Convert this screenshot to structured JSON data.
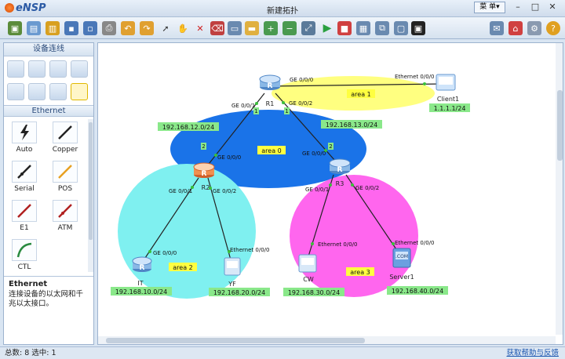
{
  "app": {
    "name": "eNSP",
    "window_title": "新建拓扑",
    "menu_label": "菜 单▾"
  },
  "left_panel": {
    "header": "设备连线",
    "ethernet_header": "Ethernet",
    "cables": [
      {
        "label": "Auto",
        "icon": "auto-lightning-icon",
        "color": "#222222"
      },
      {
        "label": "Copper",
        "icon": "copper-cable-icon",
        "color": "#222222"
      },
      {
        "label": "Serial",
        "icon": "serial-cable-icon",
        "color": "#222222"
      },
      {
        "label": "POS",
        "icon": "pos-cable-icon",
        "color": "#e8a020"
      },
      {
        "label": "E1",
        "icon": "e1-cable-icon",
        "color": "#b02020"
      },
      {
        "label": "ATM",
        "icon": "atm-cable-icon",
        "color": "#b02020"
      },
      {
        "label": "CTL",
        "icon": "ctl-cable-icon",
        "color": "#2a8a40"
      }
    ],
    "desc_title": "Ethernet",
    "desc_text": "连接设备的以太网和千兆以太接口。"
  },
  "topology": {
    "areas": [
      {
        "label": "area 1",
        "color": "#ffff80"
      },
      {
        "label": "area 0",
        "color": "#1a73e8"
      },
      {
        "label": "area 2",
        "color": "#7ff0f0"
      },
      {
        "label": "area 3",
        "color": "#ff66ee"
      }
    ],
    "devices": [
      {
        "name": "R1",
        "type": "router"
      },
      {
        "name": "R2",
        "type": "router"
      },
      {
        "name": "R3",
        "type": "router"
      },
      {
        "name": "Client1",
        "type": "client"
      },
      {
        "name": "IT",
        "type": "router"
      },
      {
        "name": "YF",
        "type": "pc"
      },
      {
        "name": "CW",
        "type": "pc"
      },
      {
        "name": "Server1",
        "type": "server"
      }
    ],
    "interfaces": {
      "r1_ge000": "GE 0/0/0",
      "r1_ge001": "GE 0/0/1",
      "r1_ge002": "GE 0/0/2",
      "client1_eth": "Ethernet 0/0/0",
      "r2_ge000": "GE 0/0/0",
      "r2_ge001": "GE 0/0/1",
      "r2_ge002": "GE 0/0/2",
      "r3_ge000": "GE 0/0/0",
      "r3_ge001": "GE 0/0/1",
      "r3_ge002": "GE 0/0/2",
      "it_ge000": "GE 0/0/0",
      "yf_eth": "Ethernet 0/0/0",
      "cw_eth": "Ethernet 0/0/0",
      "server1_eth": "Ethernet 0/0/0"
    },
    "link_tags": {
      "r1_r2_top": "1",
      "r1_r3_top": "1",
      "r1_r2_bottom": "2",
      "r1_r3_bottom": "2"
    },
    "subnets": {
      "client1": "1.1.1.1/24",
      "r1_r2": "192.168.12.0/24",
      "r1_r3": "192.168.13.0/24",
      "it": "192.168.10.0/24",
      "yf": "192.168.20.0/24",
      "cw": "192.168.30.0/24",
      "server1": "192.168.40.0/24"
    }
  },
  "status": {
    "left": "总数: 8 选中: 1",
    "right": "获取帮助与反馈"
  }
}
